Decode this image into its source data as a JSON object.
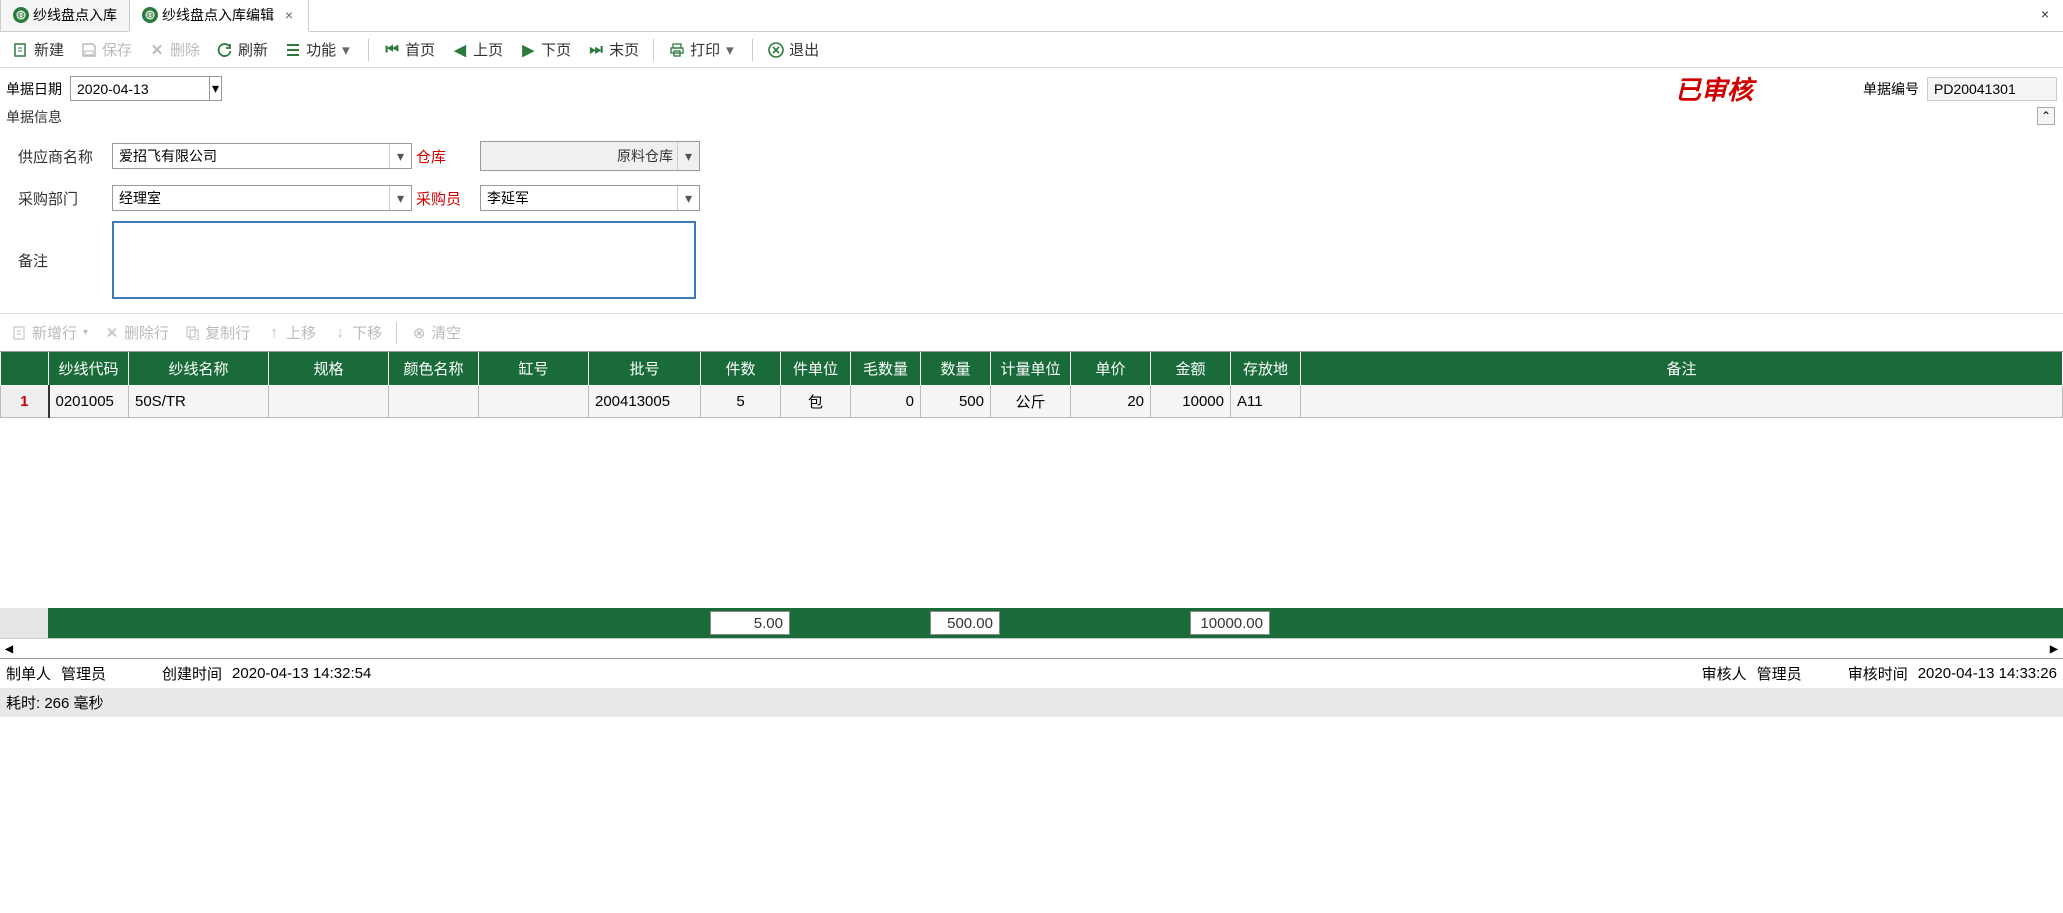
{
  "tabs": {
    "items": [
      {
        "label": "纱线盘点入库"
      },
      {
        "label": "纱线盘点入库编辑"
      }
    ]
  },
  "toolbar": {
    "new": "新建",
    "save": "保存",
    "delete": "删除",
    "refresh": "刷新",
    "func": "功能",
    "first": "首页",
    "prev": "上页",
    "next": "下页",
    "last": "末页",
    "print": "打印",
    "exit": "退出"
  },
  "top": {
    "date_label": "单据日期",
    "date_value": "2020-04-13",
    "stamp": "已审核",
    "docnum_label": "单据编号",
    "docnum_value": "PD20041301"
  },
  "info": {
    "legend": "单据信息",
    "supplier_label": "供应商名称",
    "supplier_value": "爱招飞有限公司",
    "wh_label": "仓库",
    "wh_value": "原料仓库",
    "dept_label": "采购部门",
    "dept_value": "经理室",
    "buyer_label": "采购员",
    "buyer_value": "李延军",
    "remark_label": "备注",
    "remark_value": ""
  },
  "grid_toolbar": {
    "addrow": "新增行",
    "delrow": "删除行",
    "copyrow": "复制行",
    "up": "上移",
    "down": "下移",
    "clear": "清空"
  },
  "grid": {
    "headers": [
      "",
      "纱线代码",
      "纱线名称",
      "规格",
      "颜色名称",
      "缸号",
      "批号",
      "件数",
      "件单位",
      "毛数量",
      "数量",
      "计量单位",
      "单价",
      "金额",
      "存放地",
      "备注"
    ],
    "row": {
      "num": "1",
      "code": "0201005",
      "name": "50S/TR",
      "spec": "",
      "color": "",
      "vat": "",
      "lot": "200413005",
      "pcs": "5",
      "pcs_unit": "包",
      "gross": "0",
      "qty": "500",
      "uom": "公斤",
      "price": "20",
      "amount": "10000",
      "loc": "A11",
      "remark": ""
    },
    "summary": {
      "pcs": "5.00",
      "qty": "500.00",
      "amount": "10000.00"
    }
  },
  "footer": {
    "maker_label": "制单人",
    "maker": "管理员",
    "ctime_label": "创建时间",
    "ctime": "2020-04-13 14:32:54",
    "auditor_label": "审核人",
    "auditor": "管理员",
    "atime_label": "审核时间",
    "atime": "2020-04-13 14:33:26"
  },
  "status": "耗时: 266 毫秒"
}
